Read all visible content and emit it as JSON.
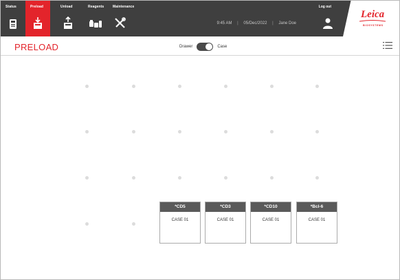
{
  "nav": {
    "items": [
      {
        "label": "Status",
        "icon": "status-icon"
      },
      {
        "label": "Preload",
        "icon": "preload-icon"
      },
      {
        "label": "Unload",
        "icon": "unload-icon"
      },
      {
        "label": "Reagents",
        "icon": "reagents-icon"
      },
      {
        "label": "Maintenance",
        "icon": "maintenance-icon"
      }
    ],
    "active": "Preload"
  },
  "status": {
    "time": "9:45 AM",
    "date": "05/Dec/2022",
    "user": "Jane Doe"
  },
  "logout_label": "Log out",
  "brand": {
    "name": "Leica",
    "subtitle": "BIOSYSTEMS"
  },
  "page": {
    "title": "PRELOAD",
    "toggle_left": "Drawer",
    "toggle_right": "Case",
    "toggle_state": "Case"
  },
  "cases": [
    {
      "name": "*CD5",
      "label": "CASE 01"
    },
    {
      "name": "*CD3",
      "label": "CASE 01"
    },
    {
      "name": "*CD10",
      "label": "CASE 01"
    },
    {
      "name": "*Bcl-6",
      "label": "CASE 01"
    }
  ],
  "colors": {
    "accent": "#e3242b",
    "topbar": "#3f3f3f",
    "case_header": "#5a5a5a"
  }
}
